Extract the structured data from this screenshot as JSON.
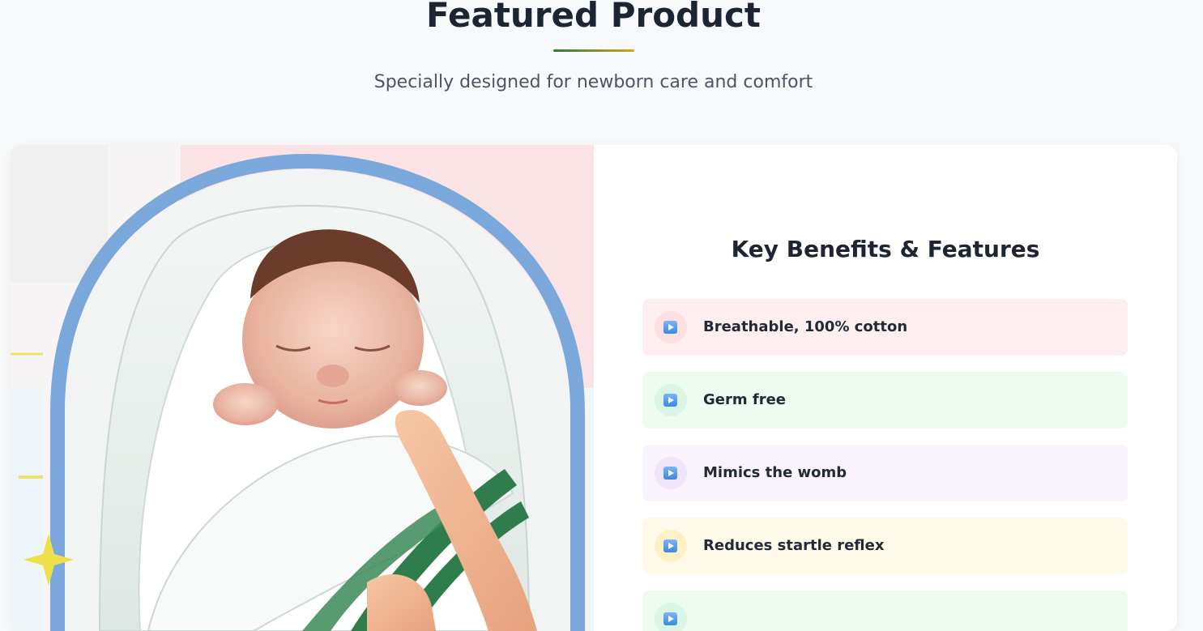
{
  "header": {
    "title": "Featured Product",
    "subtitle": "Specially designed for newborn care and comfort"
  },
  "product": {
    "image_subject": "newborn-swaddled-in-white-blanket",
    "benefits_title": "Key Benefits & Features",
    "benefits": [
      {
        "label": "Breathable, 100% cotton",
        "icon": "play-icon",
        "bg": "#fdeff0",
        "icon_bg": "#fbdfe1"
      },
      {
        "label": "Germ free",
        "icon": "play-icon",
        "bg": "#edfbf1",
        "icon_bg": "#daf5e3"
      },
      {
        "label": "Mimics the womb",
        "icon": "play-icon",
        "bg": "#f8f3fd",
        "icon_bg": "#efe4fb"
      },
      {
        "label": "Reduces startle reflex",
        "icon": "play-icon",
        "bg": "#fefaea",
        "icon_bg": "#fcf1c6"
      },
      {
        "label": "",
        "icon": "play-icon",
        "bg": "#edfbf1",
        "icon_bg": "#daf5e3"
      }
    ]
  },
  "colors": {
    "accent_green": "#2f7a3a",
    "accent_gold": "#d9a514",
    "arch_blue": "#7aa8da",
    "stripe_green": "#2f7d4c"
  }
}
